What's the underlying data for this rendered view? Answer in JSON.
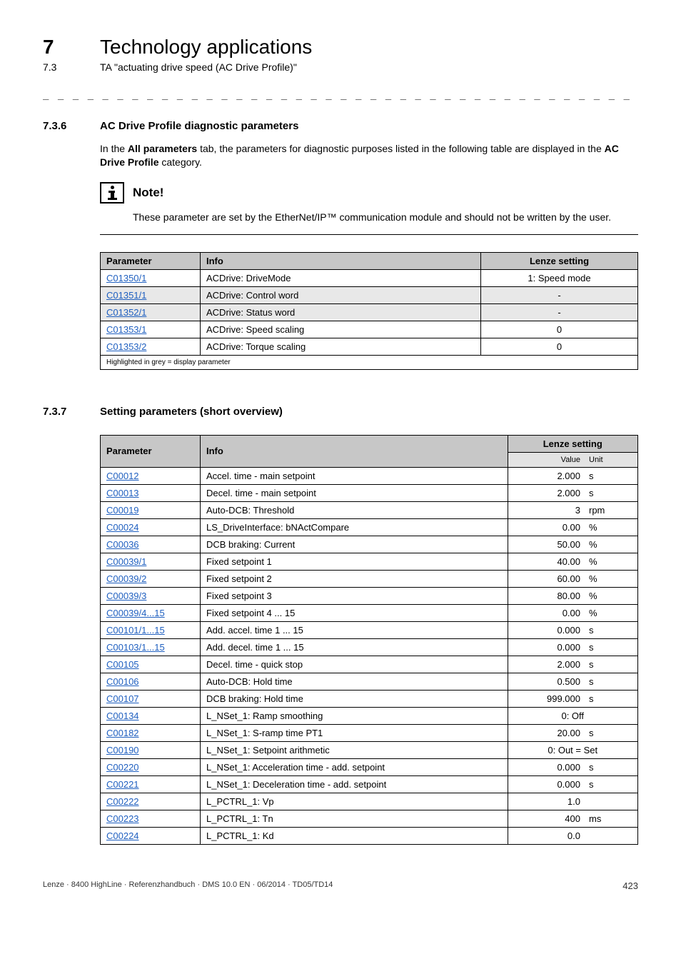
{
  "header": {
    "chapter_num": "7",
    "chapter_title": "Technology applications",
    "sub_num": "7.3",
    "sub_title": "TA \"actuating drive speed (AC Drive Profile)\""
  },
  "section1": {
    "num": "7.3.6",
    "title": "AC Drive Profile diagnostic parameters",
    "intro_pre": "In the ",
    "intro_b1": "All parameters",
    "intro_mid": " tab, the parameters for diagnostic purposes listed in the following table are displayed in the ",
    "intro_b2": "AC Drive Profile",
    "intro_post": " category."
  },
  "note": {
    "label": "Note!",
    "body": "These parameter are set by the EtherNet/IP™ communication module and should not be written by the user."
  },
  "table1": {
    "headers": {
      "p": "Parameter",
      "i": "Info",
      "l": "Lenze setting"
    },
    "rows": [
      {
        "p": "C01350/1",
        "i": "ACDrive: DriveMode",
        "l": "1: Speed mode",
        "grey": false
      },
      {
        "p": "C01351/1",
        "i": "ACDrive: Control word",
        "l": "-",
        "grey": true
      },
      {
        "p": "C01352/1",
        "i": "ACDrive: Status word",
        "l": "-",
        "grey": true
      },
      {
        "p": "C01353/1",
        "i": "ACDrive: Speed scaling",
        "l": "0",
        "grey": false
      },
      {
        "p": "C01353/2",
        "i": "ACDrive: Torque scaling",
        "l": "0",
        "grey": false
      }
    ],
    "legend": "Highlighted in grey = display parameter"
  },
  "section2": {
    "num": "7.3.7",
    "title": "Setting parameters (short overview)"
  },
  "table2": {
    "headers": {
      "p": "Parameter",
      "i": "Info",
      "l": "Lenze setting",
      "v": "Value",
      "u": "Unit"
    },
    "rows": [
      {
        "p": "C00012",
        "i": "Accel. time - main setpoint",
        "v": "2.000",
        "u": "s"
      },
      {
        "p": "C00013",
        "i": "Decel. time - main setpoint",
        "v": "2.000",
        "u": "s"
      },
      {
        "p": "C00019",
        "i": "Auto-DCB: Threshold",
        "v": "3",
        "u": "rpm"
      },
      {
        "p": "C00024",
        "i": "LS_DriveInterface: bNActCompare",
        "v": "0.00",
        "u": "%"
      },
      {
        "p": "C00036",
        "i": "DCB braking: Current",
        "v": "50.00",
        "u": "%"
      },
      {
        "p": "C00039/1",
        "i": "Fixed setpoint 1",
        "v": "40.00",
        "u": "%"
      },
      {
        "p": "C00039/2",
        "i": "Fixed setpoint 2",
        "v": "60.00",
        "u": "%"
      },
      {
        "p": "C00039/3",
        "i": "Fixed setpoint 3",
        "v": "80.00",
        "u": "%"
      },
      {
        "p": "C00039/4...15",
        "i": "Fixed setpoint 4 ... 15",
        "v": "0.00",
        "u": "%"
      },
      {
        "p": "C00101/1...15",
        "i": "Add. accel. time 1 ... 15",
        "v": "0.000",
        "u": "s"
      },
      {
        "p": "C00103/1...15",
        "i": "Add. decel. time 1 ... 15",
        "v": "0.000",
        "u": "s"
      },
      {
        "p": "C00105",
        "i": "Decel. time - quick stop",
        "v": "2.000",
        "u": "s"
      },
      {
        "p": "C00106",
        "i": "Auto-DCB: Hold time",
        "v": "0.500",
        "u": "s"
      },
      {
        "p": "C00107",
        "i": "DCB braking: Hold time",
        "v": "999.000",
        "u": "s"
      },
      {
        "p": "C00134",
        "i": "L_NSet_1: Ramp smoothing",
        "v": "0: Off",
        "u": "",
        "span": true
      },
      {
        "p": "C00182",
        "i": "L_NSet_1: S-ramp time PT1",
        "v": "20.00",
        "u": "s"
      },
      {
        "p": "C00190",
        "i": "L_NSet_1: Setpoint arithmetic",
        "v": "0: Out = Set",
        "u": "",
        "span": true
      },
      {
        "p": "C00220",
        "i": "L_NSet_1: Acceleration time - add. setpoint",
        "v": "0.000",
        "u": "s"
      },
      {
        "p": "C00221",
        "i": "L_NSet_1: Deceleration time - add. setpoint",
        "v": "0.000",
        "u": "s"
      },
      {
        "p": "C00222",
        "i": "L_PCTRL_1: Vp",
        "v": "1.0",
        "u": ""
      },
      {
        "p": "C00223",
        "i": "L_PCTRL_1: Tn",
        "v": "400",
        "u": "ms"
      },
      {
        "p": "C00224",
        "i": "L_PCTRL_1: Kd",
        "v": "0.0",
        "u": ""
      }
    ]
  },
  "footer": {
    "left": "Lenze · 8400 HighLine · Referenzhandbuch · DMS 10.0 EN · 06/2014 · TD05/TD14",
    "page": "423"
  }
}
